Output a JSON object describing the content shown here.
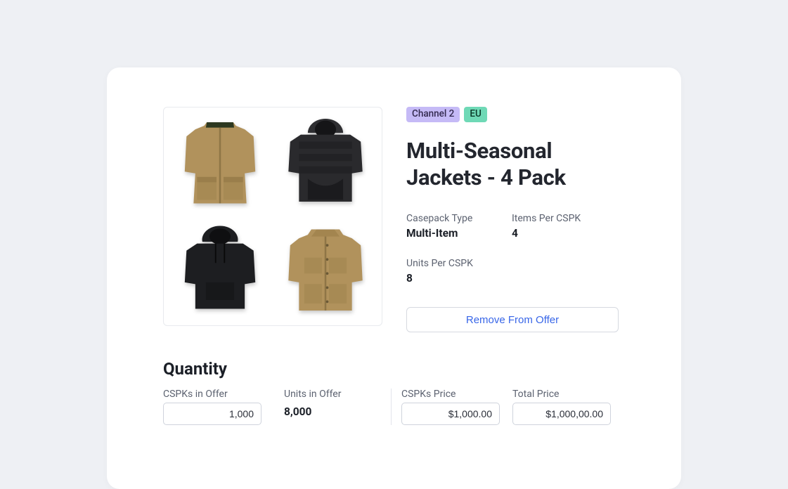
{
  "tags": {
    "channel": "Channel 2",
    "region": "EU"
  },
  "title": "Multi-Seasonal Jackets - 4 Pack",
  "meta": {
    "casepack_type_label": "Casepack Type",
    "casepack_type_value": "Multi-Item",
    "items_per_cspk_label": "Items Per CSPK",
    "items_per_cspk_value": "4",
    "units_per_cspk_label": "Units Per CSPK",
    "units_per_cspk_value": "8"
  },
  "remove_button": "Remove From Offer",
  "quantity": {
    "heading": "Quantity",
    "cspks_in_offer_label": "CSPKs in Offer",
    "cspks_in_offer_value": "1,000",
    "units_in_offer_label": "Units in Offer",
    "units_in_offer_value": "8,000",
    "cspks_price_label": "CSPKs Price",
    "cspks_price_value": "$1,000.00",
    "total_price_label": "Total Price",
    "total_price_value": "$1,000,00.00"
  }
}
